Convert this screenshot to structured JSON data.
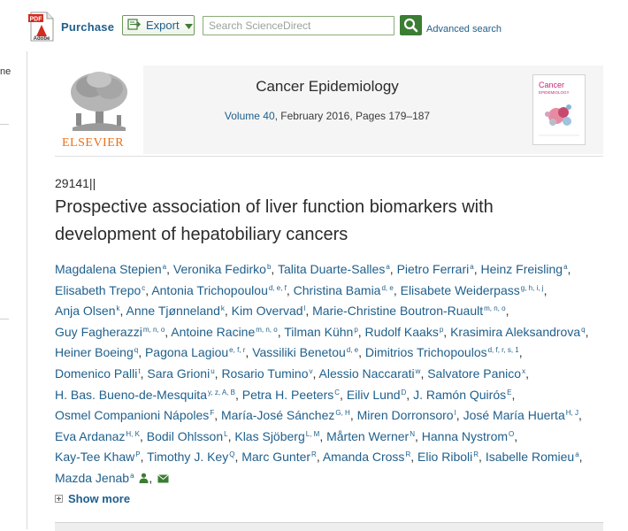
{
  "toolbar": {
    "pdf_badge": "PDF",
    "pdf_brand": "Adobe",
    "purchase_label": "Purchase",
    "export_label": "Export",
    "search_placeholder": "Search ScienceDirect",
    "advanced_search_label": "Advanced search"
  },
  "sidebar_fragment": {
    "text": "ne"
  },
  "journal": {
    "publisher": "ELSEVIER",
    "title": "Cancer Epidemiology",
    "volume_label": "Volume 40",
    "meta_rest": ", February 2016, Pages 179–187",
    "cover_title_line1": "Cancer",
    "cover_title_line2": "EPIDEMIOLOGY"
  },
  "article": {
    "id": "29141||",
    "title": "Prospective association of liver function biomarkers with development of hepatobiliary cancers"
  },
  "authors": [
    {
      "name": "Magdalena Stepien",
      "sup": "a"
    },
    {
      "name": "Veronika Fedirko",
      "sup": "b"
    },
    {
      "name": "Talita Duarte-Salles",
      "sup": "a"
    },
    {
      "name": "Pietro Ferrari",
      "sup": "a"
    },
    {
      "name": "Heinz Freisling",
      "sup": "a"
    },
    {
      "name": "Elisabeth Trepo",
      "sup": "c"
    },
    {
      "name": "Antonia Trichopoulou",
      "sup": "d, e, f"
    },
    {
      "name": "Christina Bamia",
      "sup": "d, e"
    },
    {
      "name": "Elisabete Weiderpass",
      "sup": "g, h, i, j"
    },
    {
      "name": "Anja Olsen",
      "sup": "k"
    },
    {
      "name": "Anne Tjønneland",
      "sup": "k"
    },
    {
      "name": "Kim Overvad",
      "sup": "l"
    },
    {
      "name": "Marie-Christine Boutron-Ruault",
      "sup": "m, n, o"
    },
    {
      "name": "Guy Fagherazzi",
      "sup": "m, n, o"
    },
    {
      "name": "Antoine Racine",
      "sup": "m, n, o"
    },
    {
      "name": "Tilman Kühn",
      "sup": "p"
    },
    {
      "name": "Rudolf Kaaks",
      "sup": "p"
    },
    {
      "name": "Krasimira Aleksandrova",
      "sup": "q"
    },
    {
      "name": "Heiner Boeing",
      "sup": "q"
    },
    {
      "name": "Pagona Lagiou",
      "sup": "e, f, r"
    },
    {
      "name": "Vassiliki Benetou",
      "sup": "d, e"
    },
    {
      "name": "Dimitrios Trichopoulos",
      "sup": "d, f, r, s, 1"
    },
    {
      "name": "Domenico Palli",
      "sup": "t"
    },
    {
      "name": "Sara Grioni",
      "sup": "u"
    },
    {
      "name": "Rosario Tumino",
      "sup": "v"
    },
    {
      "name": "Alessio Naccarati",
      "sup": "w"
    },
    {
      "name": "Salvatore Panico",
      "sup": "x"
    },
    {
      "name": "H. Bas. Bueno-de-Mesquita",
      "sup": "y, z, A, B"
    },
    {
      "name": "Petra H. Peeters",
      "sup": "C"
    },
    {
      "name": "Eiliv Lund",
      "sup": "D"
    },
    {
      "name": "J. Ramón Quirós",
      "sup": "E"
    },
    {
      "name": "Osmel Companioni Nápoles",
      "sup": "F"
    },
    {
      "name": "María-José Sánchez",
      "sup": "G, H"
    },
    {
      "name": "Miren Dorronsoro",
      "sup": "I"
    },
    {
      "name": "José María Huerta",
      "sup": "H, J"
    },
    {
      "name": "Eva Ardanaz",
      "sup": "H, K"
    },
    {
      "name": "Bodil Ohlsson",
      "sup": "L"
    },
    {
      "name": "Klas Sjöberg",
      "sup": "L, M"
    },
    {
      "name": "Mårten Werner",
      "sup": "N"
    },
    {
      "name": "Hanna Nystrom",
      "sup": "O"
    },
    {
      "name": "Kay-Tee Khaw",
      "sup": "P"
    },
    {
      "name": "Timothy J. Key",
      "sup": "Q"
    },
    {
      "name": "Marc Gunter",
      "sup": "R"
    },
    {
      "name": "Amanda Cross",
      "sup": "R"
    },
    {
      "name": "Elio Riboli",
      "sup": "R"
    },
    {
      "name": "Isabelle Romieu",
      "sup": "a"
    },
    {
      "name": "Mazda Jenab",
      "sup": "a"
    }
  ],
  "show_more_label": "Show more",
  "icons": {
    "pdf": "pdf-adobe-icon",
    "export": "export-icon",
    "search": "magnifier-icon",
    "person": "person-icon",
    "mail": "envelope-icon"
  },
  "colors": {
    "link_blue": "#1f5f8b",
    "green_accent": "#3c7d34",
    "elsevier_orange": "#e9711c"
  }
}
